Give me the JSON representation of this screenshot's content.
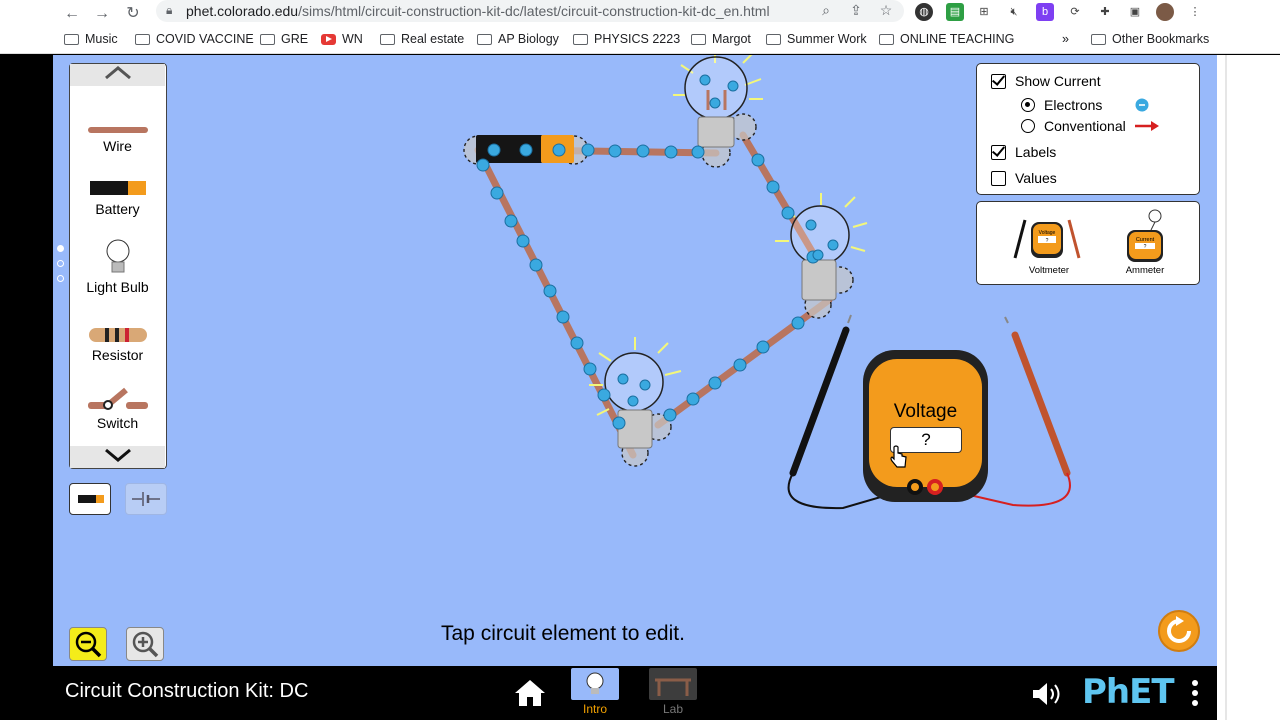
{
  "browser": {
    "url_host": "phet.colorado.edu",
    "url_path": "/sims/html/circuit-construction-kit-dc/latest/circuit-construction-kit-dc_en.html",
    "bookmarks": [
      "Music",
      "COVID VACCINE",
      "GRE",
      "WN",
      "Real estate",
      "AP Biology",
      "PHYSICS 2223",
      "Margot",
      "Summer Work",
      "ONLINE TEACHING"
    ],
    "more": "»",
    "other_bookmarks": "Other Bookmarks"
  },
  "toolbox": {
    "items": [
      {
        "label": "Wire"
      },
      {
        "label": "Battery"
      },
      {
        "label": "Light Bulb"
      },
      {
        "label": "Resistor"
      },
      {
        "label": "Switch"
      }
    ]
  },
  "display_panel": {
    "show_current": "Show Current",
    "electrons": "Electrons",
    "conventional": "Conventional",
    "labels": "Labels",
    "values": "Values",
    "show_current_checked": true,
    "electrons_selected": true,
    "labels_checked": true,
    "values_checked": false
  },
  "sensor_panel": {
    "voltmeter": "Voltmeter",
    "ammeter": "Ammeter",
    "voltmeter_screen": "Voltage",
    "ammeter_screen": "Current",
    "placeholder": "?"
  },
  "voltmeter": {
    "title": "Voltage",
    "reading": "?"
  },
  "hint": "Tap circuit element to edit.",
  "navbar": {
    "title": "Circuit Construction Kit: DC",
    "screens": [
      {
        "label": "Intro"
      },
      {
        "label": "Lab"
      }
    ],
    "brand": "PhET"
  },
  "colors": {
    "sim_bg": "#98b9fa",
    "wire": "#b87560",
    "electron": "#3aa9e0",
    "battery_orange": "#f39b1c",
    "meter_orange": "#f39b1c",
    "brand": "#5ec5f0",
    "selected_screen": "#f2a100"
  }
}
